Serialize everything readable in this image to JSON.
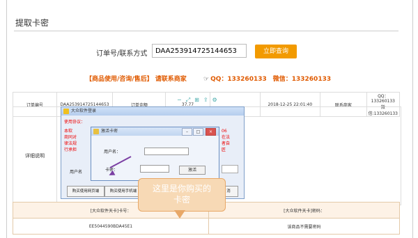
{
  "page": {
    "title": "提取卡密"
  },
  "query": {
    "label": "订单号/联系方式",
    "value": "DAA253914725144653",
    "button": "立即查询"
  },
  "contact": {
    "note": "【商品使用/咨询/售后】 请联系商家",
    "qq_text": "QQ：133260133　微信：133260133",
    "hand_icon": "☞"
  },
  "order_table": {
    "order_no_label": "订单编号",
    "order_no": "DAA253914725144653",
    "amount_label": "订单金额",
    "amount": "37.77",
    "date": "2018-12-25 22:01:40",
    "merchant_label": "联系商家",
    "merchant_qq": "QQ：133260133",
    "merchant_wechat": "微信:133260133"
  },
  "detail_label": "详细说明",
  "window_main": {
    "title": "大众软件登录",
    "agreement_label": "使用协议：",
    "text_lines": [
      "本软",
      "商同对",
      "律法规",
      "行承担"
    ],
    "right_lines": [
      "06",
      "在法",
      "者自",
      "匠"
    ],
    "user_label": "用户名",
    "buttons": [
      "购买使用网页端",
      "购买使用手机端",
      "消"
    ]
  },
  "window_login": {
    "title": "激活卡密",
    "username_label": "用户名：",
    "card_label": "卡密：",
    "button": "激活"
  },
  "bubble_text": [
    "这里是你购买的",
    "卡密"
  ],
  "card_table": {
    "card_no_header": "[大众软件天卡]卡号：",
    "card_pwd_header": "[大众软件天卡]密码：",
    "card_no": "EE5044590BDA45E1",
    "card_pwd": "该商品不需要密码"
  },
  "colors": {
    "accent": "#f29a00",
    "contact": "#e05a00",
    "bubble": "#f7d9b5",
    "arrow": "#7b3fa3"
  }
}
